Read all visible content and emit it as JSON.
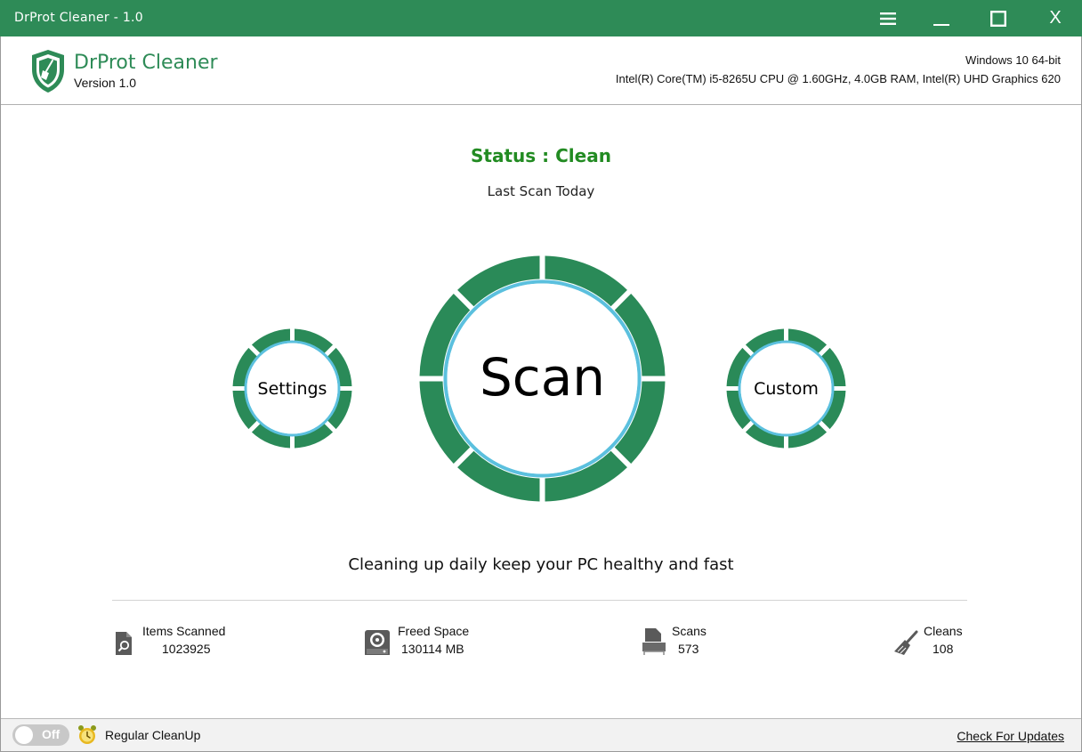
{
  "window": {
    "title": "DrProt Cleaner - 1.0",
    "controls": [
      "menu-icon",
      "minimize-icon",
      "maximize-icon",
      "close-icon"
    ],
    "close_label": "X"
  },
  "header": {
    "app_name": "DrProt Cleaner",
    "version": "Version 1.0",
    "os": "Windows 10 64-bit",
    "hardware": "Intel(R) Core(TM) i5-8265U CPU @ 1.60GHz, 4.0GB RAM, Intel(R) UHD Graphics 620"
  },
  "status": {
    "text": "Status : Clean",
    "last_scan": "Last Scan Today"
  },
  "actions": {
    "settings": "Settings",
    "scan": "Scan",
    "custom": "Custom"
  },
  "tagline": "Cleaning up daily keep your PC healthy and fast",
  "stats": {
    "items_scanned": {
      "label": "Items Scanned",
      "value": "1023925",
      "icon": "search-document-icon"
    },
    "freed_space": {
      "label": "Freed Space",
      "value": "130114 MB",
      "icon": "hard-drive-icon"
    },
    "scans": {
      "label": "Scans",
      "value": "573",
      "icon": "scanner-icon"
    },
    "cleans": {
      "label": "Cleans",
      "value": "108",
      "icon": "broom-icon"
    }
  },
  "footer": {
    "toggle_state": "Off",
    "regular_cleanup": "Regular CleanUp",
    "check_updates": "Check For Updates"
  },
  "colors": {
    "brand_green": "#2e8b57",
    "ring_green": "#2a8a58",
    "ring_inner_blue": "#5bc0de",
    "status_green": "#228b22"
  }
}
